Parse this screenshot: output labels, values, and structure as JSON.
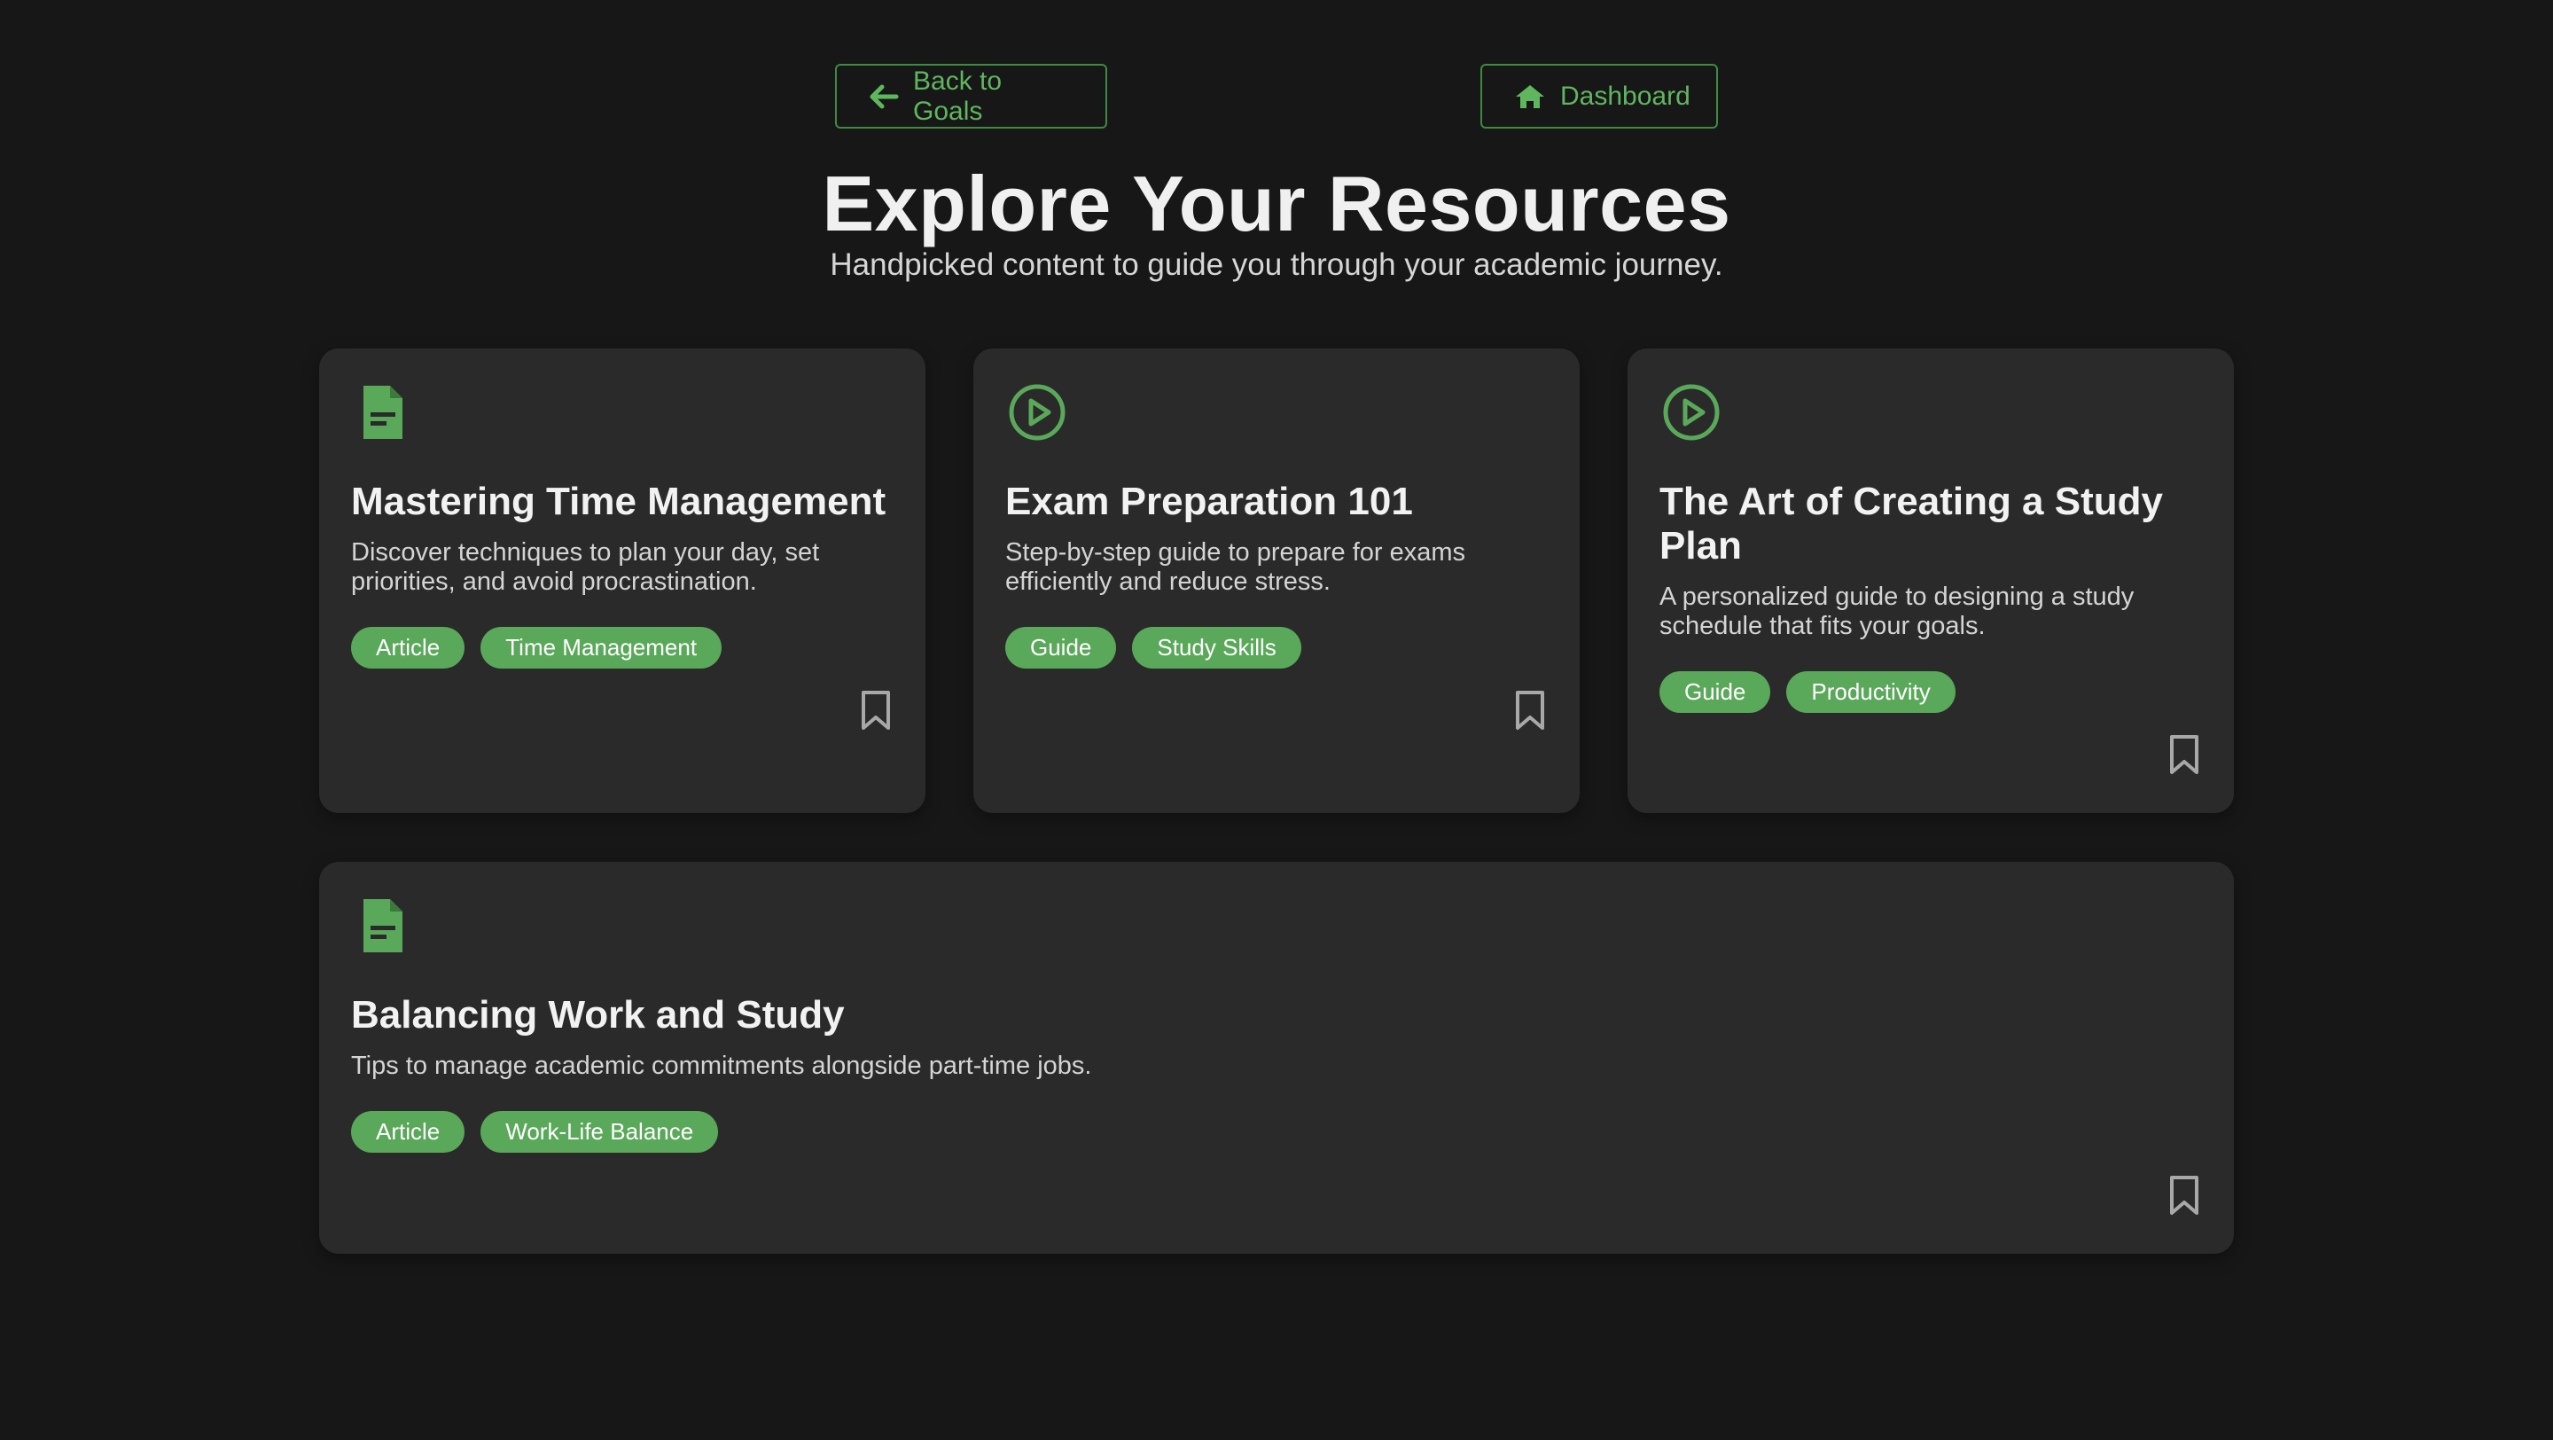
{
  "nav": {
    "back_label": "Back to Goals",
    "dashboard_label": "Dashboard"
  },
  "header": {
    "title": "Explore Your Resources",
    "subtitle": "Handpicked content to guide you through your academic journey."
  },
  "colors": {
    "accent": "#5aa85a",
    "background": "#171717",
    "card": "#2a2a2a"
  },
  "resources": [
    {
      "icon": "document-icon",
      "title": "Mastering Time Management",
      "description": "Discover techniques to plan your day, set priorities, and avoid procrastination.",
      "tags": [
        "Article",
        "Time Management"
      ]
    },
    {
      "icon": "play-circle-icon",
      "title": "Exam Preparation 101",
      "description": "Step-by-step guide to prepare for exams efficiently and reduce stress.",
      "tags": [
        "Guide",
        "Study Skills"
      ]
    },
    {
      "icon": "play-circle-icon",
      "title": "The Art of Creating a Study Plan",
      "description": "A personalized guide to designing a study schedule that fits your goals.",
      "tags": [
        "Guide",
        "Productivity"
      ]
    },
    {
      "icon": "document-icon",
      "title": "Balancing Work and Study",
      "description": "Tips to manage academic commitments alongside part-time jobs.",
      "tags": [
        "Article",
        "Work-Life Balance"
      ]
    }
  ]
}
